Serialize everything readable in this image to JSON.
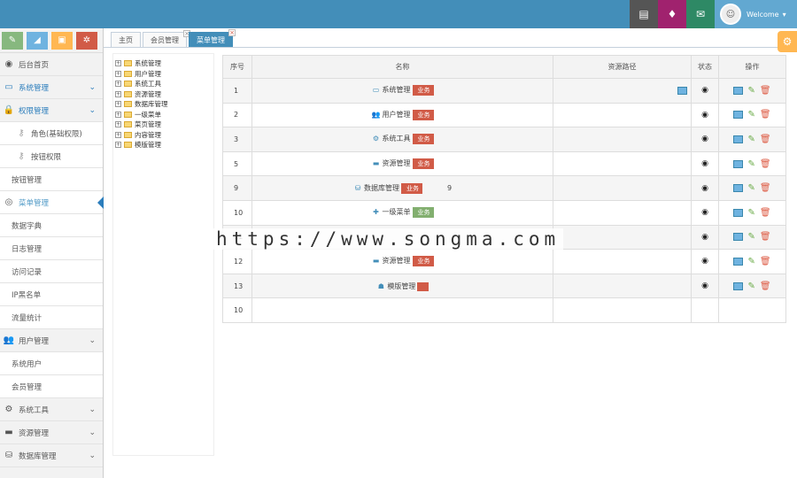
{
  "topbar": {
    "buttons": [
      {
        "name": "tasks-icon",
        "color": "#555555",
        "glyph": "▤"
      },
      {
        "name": "bell-icon",
        "color": "#a0226e",
        "glyph": "🔔"
      },
      {
        "name": "envelope-icon",
        "color": "#2e8965",
        "glyph": "✉"
      }
    ],
    "welcome": "Welcome",
    "colors": {
      "bar": "#438eb9",
      "user": "#62a8d1"
    }
  },
  "shortcuts": [
    {
      "name": "pencil-icon",
      "color": "#87b87f",
      "glyph": "✎"
    },
    {
      "name": "signal-icon",
      "color": "#6fb3e0",
      "glyph": "◢"
    },
    {
      "name": "save-icon",
      "color": "#ffb752",
      "glyph": "▣"
    },
    {
      "name": "cogs-icon",
      "color": "#d15b47",
      "glyph": "✲"
    }
  ],
  "sidebar": {
    "items": [
      {
        "label": "后台首页",
        "icon": "dashboard-icon",
        "glyph": "◉"
      },
      {
        "label": "系统管理",
        "icon": "desktop-icon",
        "glyph": "▭",
        "active": true
      },
      {
        "label": "权限管理",
        "icon": "lock-icon",
        "glyph": "🔒",
        "active": true
      },
      {
        "label": "角色(基础权限)",
        "icon": "key-icon",
        "glyph": "⚷",
        "sub2": true
      },
      {
        "label": "按钮权限",
        "icon": "key-icon",
        "glyph": "⚷",
        "sub2": true
      },
      {
        "label": "按钮管理",
        "sub": true
      },
      {
        "label": "菜单管理",
        "icon": "eye-icon",
        "glyph": "◎",
        "selected": true
      },
      {
        "label": "数据字典",
        "sub": true
      },
      {
        "label": "日志管理",
        "sub": true
      },
      {
        "label": "访问记录",
        "sub": true
      },
      {
        "label": "IP黑名单",
        "sub": true
      },
      {
        "label": "流量统计",
        "sub": true
      },
      {
        "label": "用户管理",
        "icon": "users-icon",
        "glyph": "👥"
      },
      {
        "label": "系统用户",
        "sub": true
      },
      {
        "label": "会员管理",
        "sub": true
      },
      {
        "label": "系统工具",
        "icon": "cog-icon",
        "glyph": "⚙"
      },
      {
        "label": "资源管理",
        "icon": "credit-card-icon",
        "glyph": "▬"
      },
      {
        "label": "数据库管理",
        "icon": "database-icon",
        "glyph": "⛁"
      }
    ]
  },
  "tabs": [
    {
      "label": "主页"
    },
    {
      "label": "会员管理"
    },
    {
      "label": "菜单管理",
      "active": true
    }
  ],
  "tree": [
    "系统管理",
    "用户管理",
    "系统工具",
    "资源管理",
    "数据库管理",
    "一级菜单",
    "菜页管理",
    "内容管理",
    "模版管理"
  ],
  "grid": {
    "headers": [
      "序号",
      "名称",
      "资源路径",
      "状态",
      "操作"
    ],
    "rows": [
      {
        "no": "1",
        "name": "系统管理",
        "glyph": "▭",
        "tag": "业务",
        "path": "",
        "pic": true
      },
      {
        "no": "2",
        "name": "用户管理",
        "glyph": "👥",
        "tag": "业务",
        "path": ""
      },
      {
        "no": "3",
        "name": "系统工具",
        "glyph": "⚙",
        "tag": "业务",
        "path": ""
      },
      {
        "no": "5",
        "name": "资源管理",
        "glyph": "▬",
        "tag": "业务",
        "path": ""
      },
      {
        "no": "9",
        "name": "数据库管理",
        "glyph": "⛁",
        "tag": "业务",
        "extra": "9",
        "path": ""
      },
      {
        "no": "10",
        "name": "一级菜单",
        "glyph": "✚",
        "tag": "业务",
        "tagColor": "green",
        "path": ""
      },
      {
        "no": "11",
        "name": "",
        "glyph": "",
        "tag": "",
        "path": ""
      },
      {
        "no": "12",
        "name": "资源管理",
        "glyph": "▬",
        "tag": "业务",
        "path": ""
      },
      {
        "no": "13",
        "name": "模版管理",
        "glyph": "☗",
        "tag": "",
        "path": ""
      },
      {
        "no": "10",
        "name": "",
        "glyph": "",
        "tag": "",
        "path": "",
        "empty": true
      }
    ]
  },
  "watermark": "https://www.songma.com"
}
